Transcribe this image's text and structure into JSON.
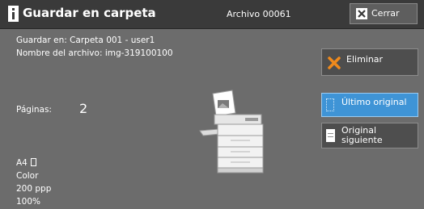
{
  "titlebar": {
    "title": "Guardar en carpeta",
    "file_label": "Archivo 00061",
    "close_label": "Cerrar",
    "icon": "info-icon"
  },
  "info": {
    "saved_in": "Guardar en: Carpeta 001 - user1",
    "file_name": "Nombre del archivo: img-319100100"
  },
  "pages": {
    "label": "Páginas:",
    "value": "2"
  },
  "attributes": {
    "paper_size": "A4",
    "color": "Color",
    "resolution": "200 ppp",
    "scale": "100%"
  },
  "buttons": {
    "delete": "Eliminar",
    "last_original": "Último original",
    "next_original_line1": "Original",
    "next_original_line2": "siguiente"
  },
  "colors": {
    "titlebar": "#3a3a3a",
    "background": "#6c6c6c",
    "accent_blue": "#3f94d6",
    "delete_icon": "#f08a1c"
  },
  "icons": {
    "delete": "x-icon",
    "last_original": "dotted-page-icon",
    "next_original": "page-icon",
    "device": "printer-icon"
  }
}
